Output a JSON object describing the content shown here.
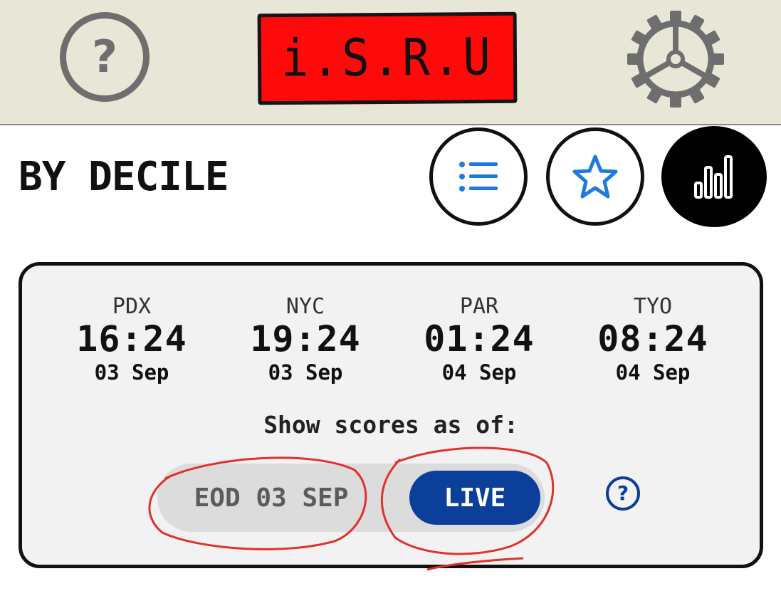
{
  "header": {
    "logo_text": "i.S.R.U",
    "help_glyph": "?",
    "icons": {
      "help": "help-circle-icon",
      "settings": "gear-icon"
    }
  },
  "title": "BY DECILE",
  "view_buttons": [
    {
      "name": "list-view",
      "icon": "list-icon",
      "selected": false
    },
    {
      "name": "favorites-view",
      "icon": "star-icon",
      "selected": false
    },
    {
      "name": "decile-chart-view",
      "icon": "bar-chart-icon",
      "selected": true
    }
  ],
  "timezones": [
    {
      "city": "PDX",
      "time": "16:24",
      "date": "03 Sep"
    },
    {
      "city": "NYC",
      "time": "19:24",
      "date": "03 Sep"
    },
    {
      "city": "PAR",
      "time": "01:24",
      "date": "04 Sep"
    },
    {
      "city": "TYO",
      "time": "08:24",
      "date": "04 Sep"
    }
  ],
  "scores": {
    "label": "Show scores as of:",
    "options": [
      "EOD 03 SEP",
      "LIVE"
    ],
    "selected": "LIVE",
    "help_glyph": "?"
  },
  "colors": {
    "header_bg": "#e7e6d7",
    "logo_bg": "#ff0a0a",
    "accent_blue": "#0b3f9a",
    "icon_blue": "#1f7ae0",
    "annotation_red": "#e0312a"
  }
}
